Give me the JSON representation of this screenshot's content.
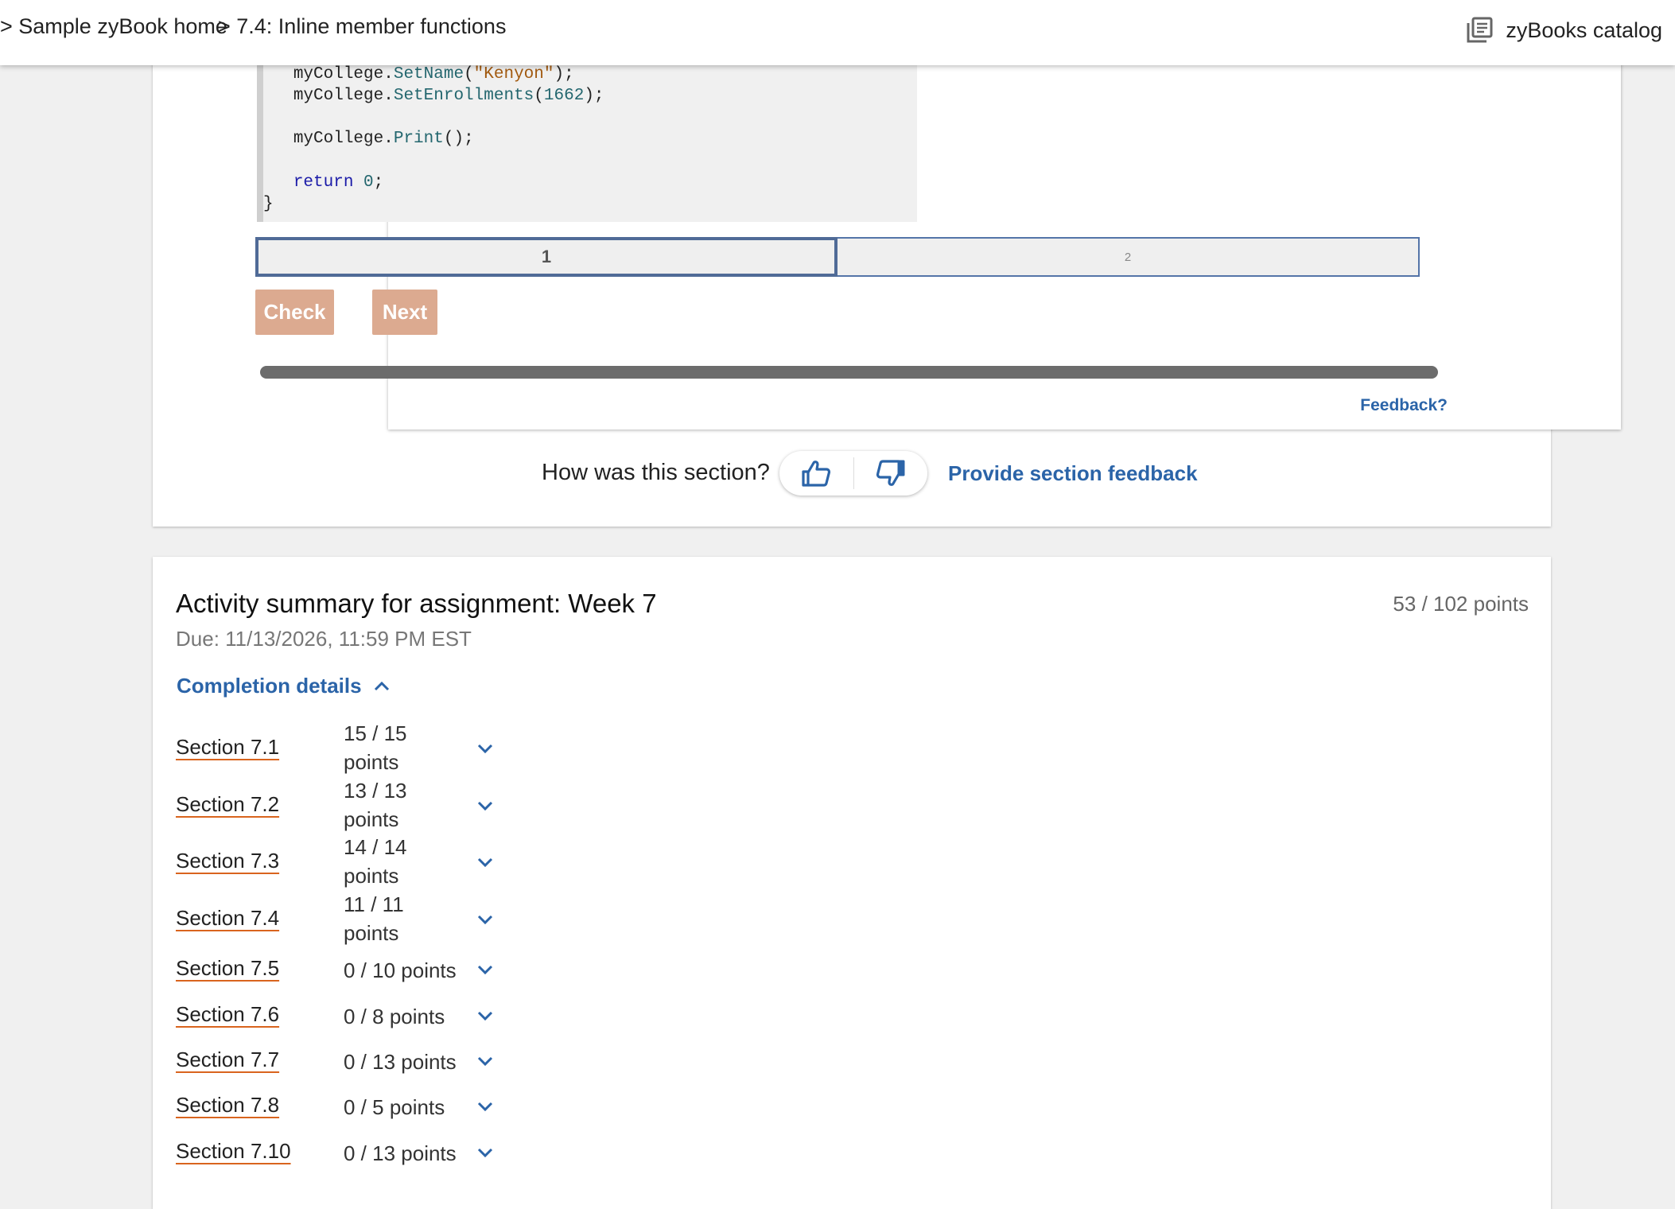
{
  "breadcrumb": {
    "home": "> Sample zyBook home",
    "section": "> 7.4: Inline member functions"
  },
  "header": {
    "catalog_label": "zyBooks catalog",
    "catalog_icon": "book-list-icon"
  },
  "code": {
    "lines": [
      {
        "indent": "   ",
        "obj": "myCollege.",
        "fn": "SetName",
        "open": "(",
        "arg": "\"Kenyon\"",
        "close": ");"
      },
      {
        "indent": "   ",
        "obj": "myCollege.",
        "fn": "SetEnrollments",
        "open": "(",
        "arg": "1662",
        "close": ");"
      },
      {
        "indent": "   ",
        "obj": "myCollege.",
        "fn": "Print",
        "open": "(",
        "arg": "",
        "close": ");"
      },
      {
        "keyword": "return",
        "value": "0",
        "end": ";"
      },
      {
        "brace": "}"
      }
    ]
  },
  "steps": {
    "step1": "1",
    "step2": "2",
    "active": 1
  },
  "buttons": {
    "check": "Check",
    "next": "Next"
  },
  "progress": {
    "fraction": 1.0
  },
  "activity_feedback": "Feedback?",
  "rating": {
    "question": "How was this section?",
    "up_icon": "thumbs-up-icon",
    "down_icon": "thumbs-down-icon",
    "feedback_link": "Provide section feedback"
  },
  "summary": {
    "title": "Activity summary for assignment: Week 7",
    "points": "53 / 102 points",
    "due": "Due: 11/13/2026, 11:59 PM EST",
    "completion_label": "Completion details",
    "sections": [
      {
        "name": "Section 7.1",
        "points": "15 / 15 points"
      },
      {
        "name": "Section 7.2",
        "points": "13 / 13 points"
      },
      {
        "name": "Section 7.3",
        "points": "14 / 14 points"
      },
      {
        "name": "Section 7.4",
        "points": "11 / 11 points"
      },
      {
        "name": "Section 7.5",
        "points": "0 / 10 points"
      },
      {
        "name": "Section 7.6",
        "points": "0 / 8 points"
      },
      {
        "name": "Section 7.7",
        "points": "0 / 13 points"
      },
      {
        "name": "Section 7.8",
        "points": "0 / 5 points"
      },
      {
        "name": "Section 7.10",
        "points": "0 / 13 points"
      }
    ]
  },
  "colors": {
    "link": "#2b64a8",
    "button_disabled": "#dcaa90",
    "underline": "#d9641e",
    "progress": "#6c6c6c"
  }
}
